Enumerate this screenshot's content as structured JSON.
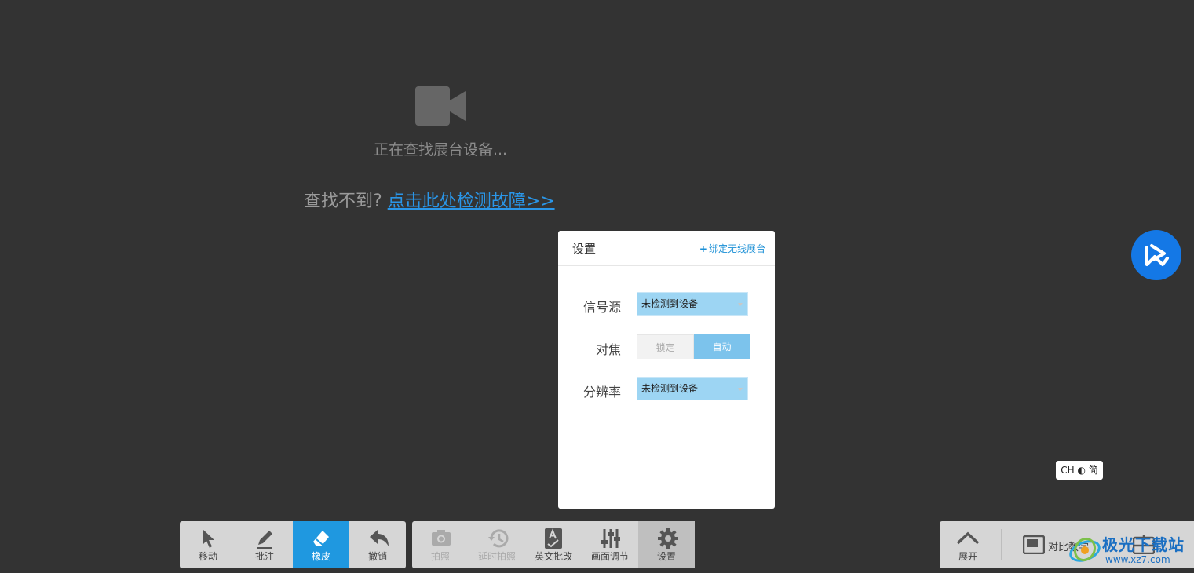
{
  "status": {
    "searching_text": "正在查找展台设备...",
    "notfound_prefix": "查找不到?",
    "diagnose_link": "点击此处检测故障>>"
  },
  "settings_panel": {
    "title": "设置",
    "bind_wireless": "绑定无线展台",
    "signal_source": {
      "label": "信号源",
      "value": "未检测到设备"
    },
    "focus": {
      "label": "对焦",
      "options": [
        "锁定",
        "自动"
      ],
      "selected": "自动"
    },
    "resolution": {
      "label": "分辨率",
      "value": "未检测到设备"
    }
  },
  "ime_indicator": "CH ◐ 简",
  "toolbar_left": [
    {
      "label": "移动",
      "icon": "cursor-icon",
      "state": "normal"
    },
    {
      "label": "批注",
      "icon": "pen-icon",
      "state": "normal"
    },
    {
      "label": "橡皮",
      "icon": "eraser-icon",
      "state": "active"
    },
    {
      "label": "撤销",
      "icon": "undo-icon",
      "state": "normal"
    }
  ],
  "toolbar_middle": [
    {
      "label": "拍照",
      "icon": "camera-icon",
      "state": "disabled"
    },
    {
      "label": "延时拍照",
      "icon": "history-icon",
      "state": "disabled"
    },
    {
      "label": "英文批改",
      "icon": "spellcheck-icon",
      "state": "normal"
    },
    {
      "label": "画面调节",
      "icon": "sliders-icon",
      "state": "normal"
    },
    {
      "label": "设置",
      "icon": "gear-icon",
      "state": "current"
    }
  ],
  "toolbar_right": {
    "expand_label": "展开",
    "compare_label": "对比教学"
  },
  "watermark": {
    "text": "极光下载站",
    "url": "www.xz7.com"
  },
  "colors": {
    "background": "#333333",
    "accent": "#1f98e0",
    "link": "#2a96e8",
    "fab": "#1478e6"
  }
}
